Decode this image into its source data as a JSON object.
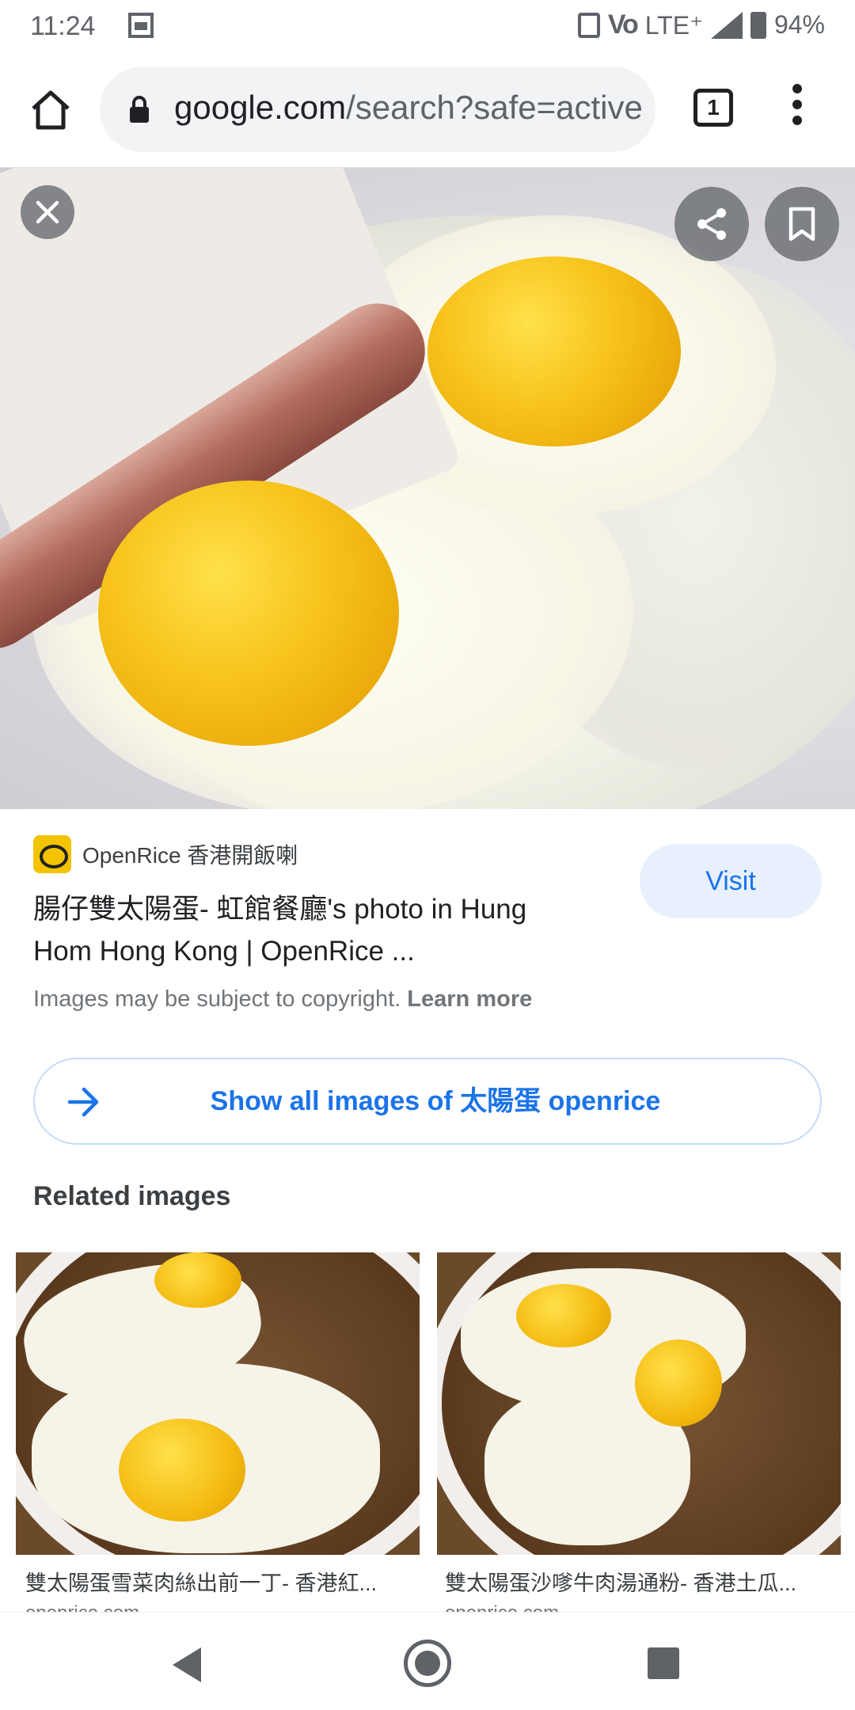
{
  "status_bar": {
    "time": "11:24",
    "network": "LTE⁺",
    "volte": "VoLTE",
    "battery": "94%"
  },
  "browser": {
    "url_domain": "google.com",
    "url_path": "/search?safe=active",
    "tab_count": "1"
  },
  "result": {
    "source_name": "OpenRice 香港開飯喇",
    "title": "腸仔雙太陽蛋- 虹館餐廳's photo in Hung Hom Hong Kong | OpenRice ...",
    "visit_label": "Visit",
    "copyright_text": "Images may be subject to copyright.",
    "learn_more": "Learn more",
    "show_all_label": "Show all images of 太陽蛋 openrice"
  },
  "related": {
    "heading": "Related images",
    "items": [
      {
        "caption": "雙太陽蛋雪菜肉絲出前一丁- 香港紅...",
        "source": "openrice.com"
      },
      {
        "caption": "雙太陽蛋沙嗲牛肉湯通粉- 香港土瓜...",
        "source": "openrice.com"
      }
    ]
  },
  "colors": {
    "accent": "#1a73e8",
    "visit_bg": "#e8f0fe",
    "omnibox_bg": "#f1f3f4"
  },
  "icons": [
    "home-icon",
    "lock-icon",
    "tabs-icon",
    "more-vert-icon",
    "close-icon",
    "share-icon",
    "bookmark-icon",
    "arrow-right-icon",
    "back-icon",
    "home-circle-icon",
    "recents-icon"
  ]
}
